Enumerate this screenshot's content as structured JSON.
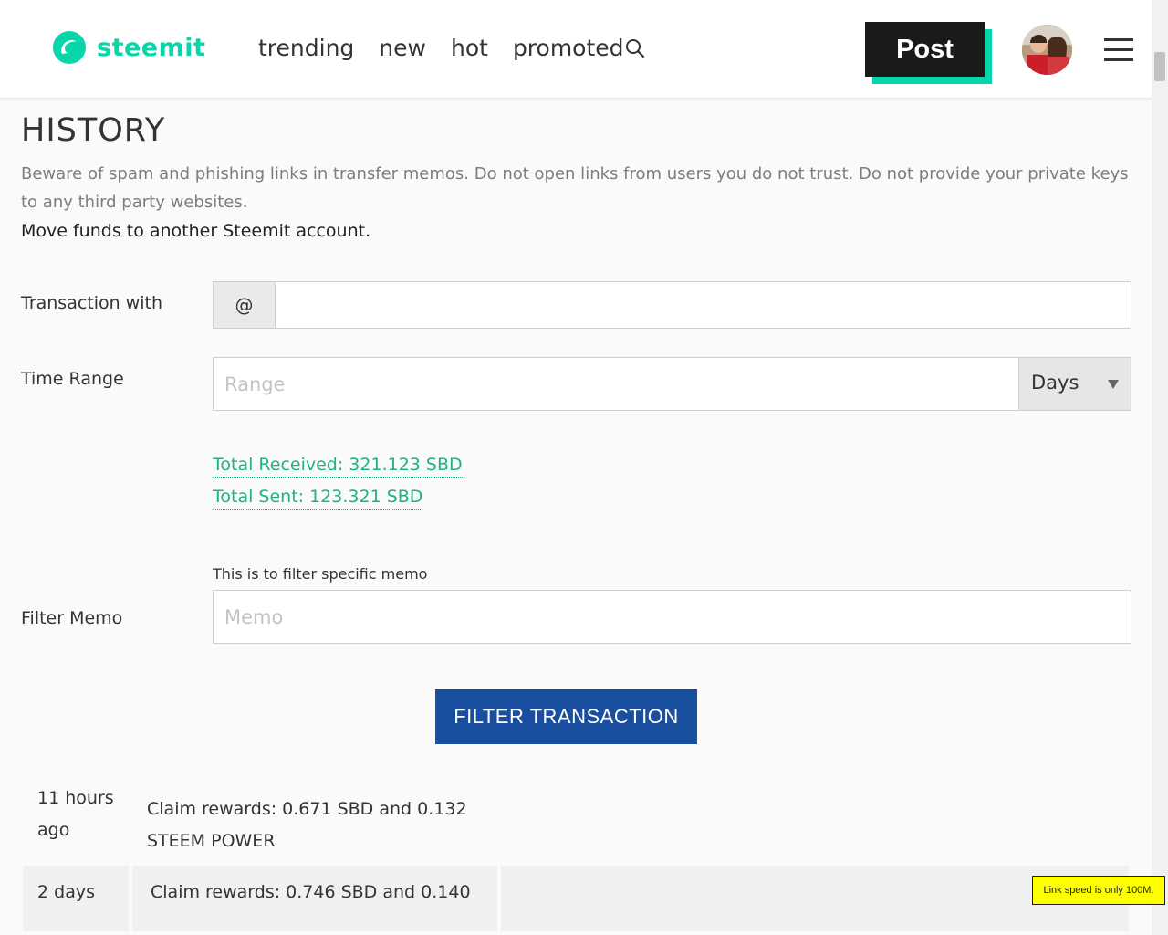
{
  "header": {
    "brand": "steemit",
    "nav": [
      "trending",
      "new",
      "hot",
      "promoted"
    ],
    "post_label": "Post"
  },
  "page": {
    "title": "HISTORY",
    "warning": "Beware of spam and phishing links in transfer memos. Do not open links from users you do not trust. Do not provide your private keys to any third party websites.",
    "subtitle": "Move funds to another Steemit account."
  },
  "form": {
    "transaction_with_label": "Transaction with",
    "at_symbol": "@",
    "transaction_with_value": "",
    "time_range_label": "Time Range",
    "range_placeholder": "Range",
    "unit_selected": "Days",
    "total_received": "Total Received: 321.123 SBD",
    "total_sent": "Total Sent: 123.321 SBD",
    "memo_hint": "This is to filter specific memo",
    "filter_memo_label": "Filter Memo",
    "memo_placeholder": "Memo",
    "filter_button": "FILTER TRANSACTION"
  },
  "history": [
    {
      "time": "11 hours ago",
      "description": "Claim rewards: 0.671 SBD and 0.132 STEEM POWER"
    },
    {
      "time": "2 days",
      "description": "Claim rewards: 0.746 SBD and 0.140"
    }
  ],
  "tooltip": "Link speed is only 100M.",
  "colors": {
    "brand": "#06d6a9",
    "accent_link": "#1fb37f",
    "button": "#1a4fa0"
  },
  "icons": [
    "steemit-logo-icon",
    "search-icon",
    "menu-icon",
    "avatar"
  ]
}
